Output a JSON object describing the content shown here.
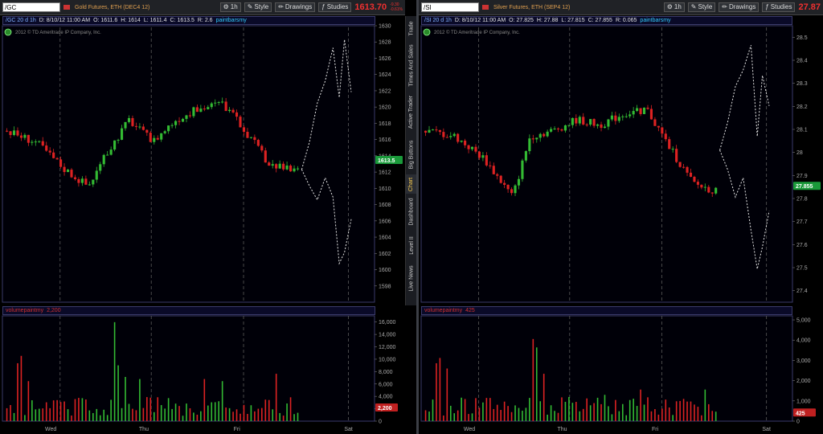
{
  "copyright": "2012 © TD Ameritrade IP Company, Inc.",
  "toolbar_labels": {
    "interval": "1h",
    "style": "Style",
    "drawings": "Drawings",
    "studies": "Studies"
  },
  "side_tabs": [
    {
      "label": "Trade",
      "active": false
    },
    {
      "label": "Times And Sales",
      "active": false
    },
    {
      "label": "Active Trader",
      "active": false
    },
    {
      "label": "Big Buttons",
      "active": false
    },
    {
      "label": "Chart",
      "active": true
    },
    {
      "label": "Dashboard",
      "active": false
    },
    {
      "label": "Level II",
      "active": false
    },
    {
      "label": "Live News",
      "active": false
    }
  ],
  "colors": {
    "up": "#33bb33",
    "down": "#dd2222",
    "projection": "#e8e8e8",
    "price_badge": "#1a9a3a",
    "volume_badge": "#c02020",
    "grid": "#5a5a5a"
  },
  "x_labels": [
    "Wed",
    "Thu",
    "Fri",
    "Sat"
  ],
  "charts": [
    {
      "symbol": "/GC",
      "description": "Gold Futures, ETH (DEC4 12)",
      "last_price": "1613.70",
      "change_top": "-9.30",
      "change_bottom": "-0.61%",
      "info": {
        "symbol_period": "/GC 20 d 1h",
        "date": "D: 8/10/12 11:00 AM",
        "open": "O: 1611.6",
        "high": "H: 1614",
        "low": "L: 1611.4",
        "close": "C: 1613.5",
        "range": "R: 2.6",
        "study": "paintbarsmy"
      },
      "price_axis": {
        "min": 1596,
        "max": 1630,
        "ticks": [
          "1630",
          "1628",
          "1626",
          "1624",
          "1622",
          "1620",
          "1618",
          "1616",
          "1614",
          "1612",
          "1610",
          "1608",
          "1606",
          "1604",
          "1602",
          "1600",
          "1598"
        ]
      },
      "current_price_label": "1613.5",
      "volume_label": "volumepaintmy",
      "volume_value": "2,200",
      "volume_axis": {
        "max": 17000,
        "ticks": [
          "16,000",
          "14,000",
          "12,000",
          "10,000",
          "8,000",
          "6,000",
          "4,000",
          "2,000",
          "0"
        ]
      },
      "volume_badge": "2,200"
    },
    {
      "symbol": "/SI",
      "description": "Silver Futures, ETH (SEP4 12)",
      "last_price": "27.87",
      "change_top": "",
      "change_bottom": "",
      "info": {
        "symbol_period": "/SI 20 d 1h",
        "date": "D: 8/10/12 11:00 AM",
        "open": "O: 27.825",
        "high": "H: 27.88",
        "low": "L: 27.815",
        "close": "C: 27.855",
        "range": "R: 0.065",
        "study": "paintbarsmy"
      },
      "price_axis": {
        "min": 27.35,
        "max": 28.55,
        "ticks": [
          "28.5",
          "28.4",
          "28.3",
          "28.2",
          "28.1",
          "28",
          "27.9",
          "27.8",
          "27.7",
          "27.6",
          "27.5",
          "27.4"
        ]
      },
      "current_price_label": "27.855",
      "volume_label": "volumepaintmy",
      "volume_value": "425",
      "volume_axis": {
        "max": 5200,
        "ticks": [
          "5,000",
          "4,000",
          "3,000",
          "2,000",
          "1,000",
          "0"
        ]
      },
      "volume_badge": "425"
    }
  ]
}
